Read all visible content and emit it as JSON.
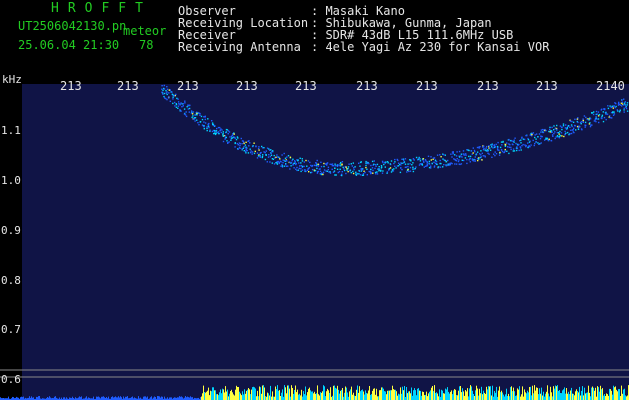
{
  "header": {
    "brand": "HROFFT",
    "filename": "UT2506042130.pn",
    "meteor_label": "meteor",
    "datetime": "25.06.04 21:30",
    "count": "78",
    "info": [
      {
        "label": "Observer",
        "value": ": Masaki Kano"
      },
      {
        "label": "Receiving Location",
        "value": ": Shibukawa, Gunma, Japan"
      },
      {
        "label": "Receiver",
        "value": ": SDR# 43dB L15 111.6MHz USB"
      },
      {
        "label": "Receiving Antenna",
        "value": ": 4ele Yagi Az 230 for Kansai VOR"
      }
    ]
  },
  "spectrogram": {
    "y_unit": "kHz",
    "y_ticks": [
      {
        "value": 1.1,
        "label": "1.1"
      },
      {
        "value": 1.0,
        "label": "1.0"
      },
      {
        "value": 0.9,
        "label": "0.9"
      },
      {
        "value": 0.8,
        "label": "0.8"
      },
      {
        "value": 0.7,
        "label": "0.7"
      },
      {
        "value": 0.6,
        "label": "0.6"
      }
    ],
    "x_ticks": [
      "213",
      "213",
      "213",
      "213",
      "213",
      "213",
      "213",
      "213",
      "213",
      "2140"
    ],
    "colors": {
      "background": "#101446",
      "signal_low": "#1f5cff",
      "signal_mid": "#00d4ff",
      "signal_high": "#ffff40",
      "grid": "#9a9a9a"
    }
  }
}
